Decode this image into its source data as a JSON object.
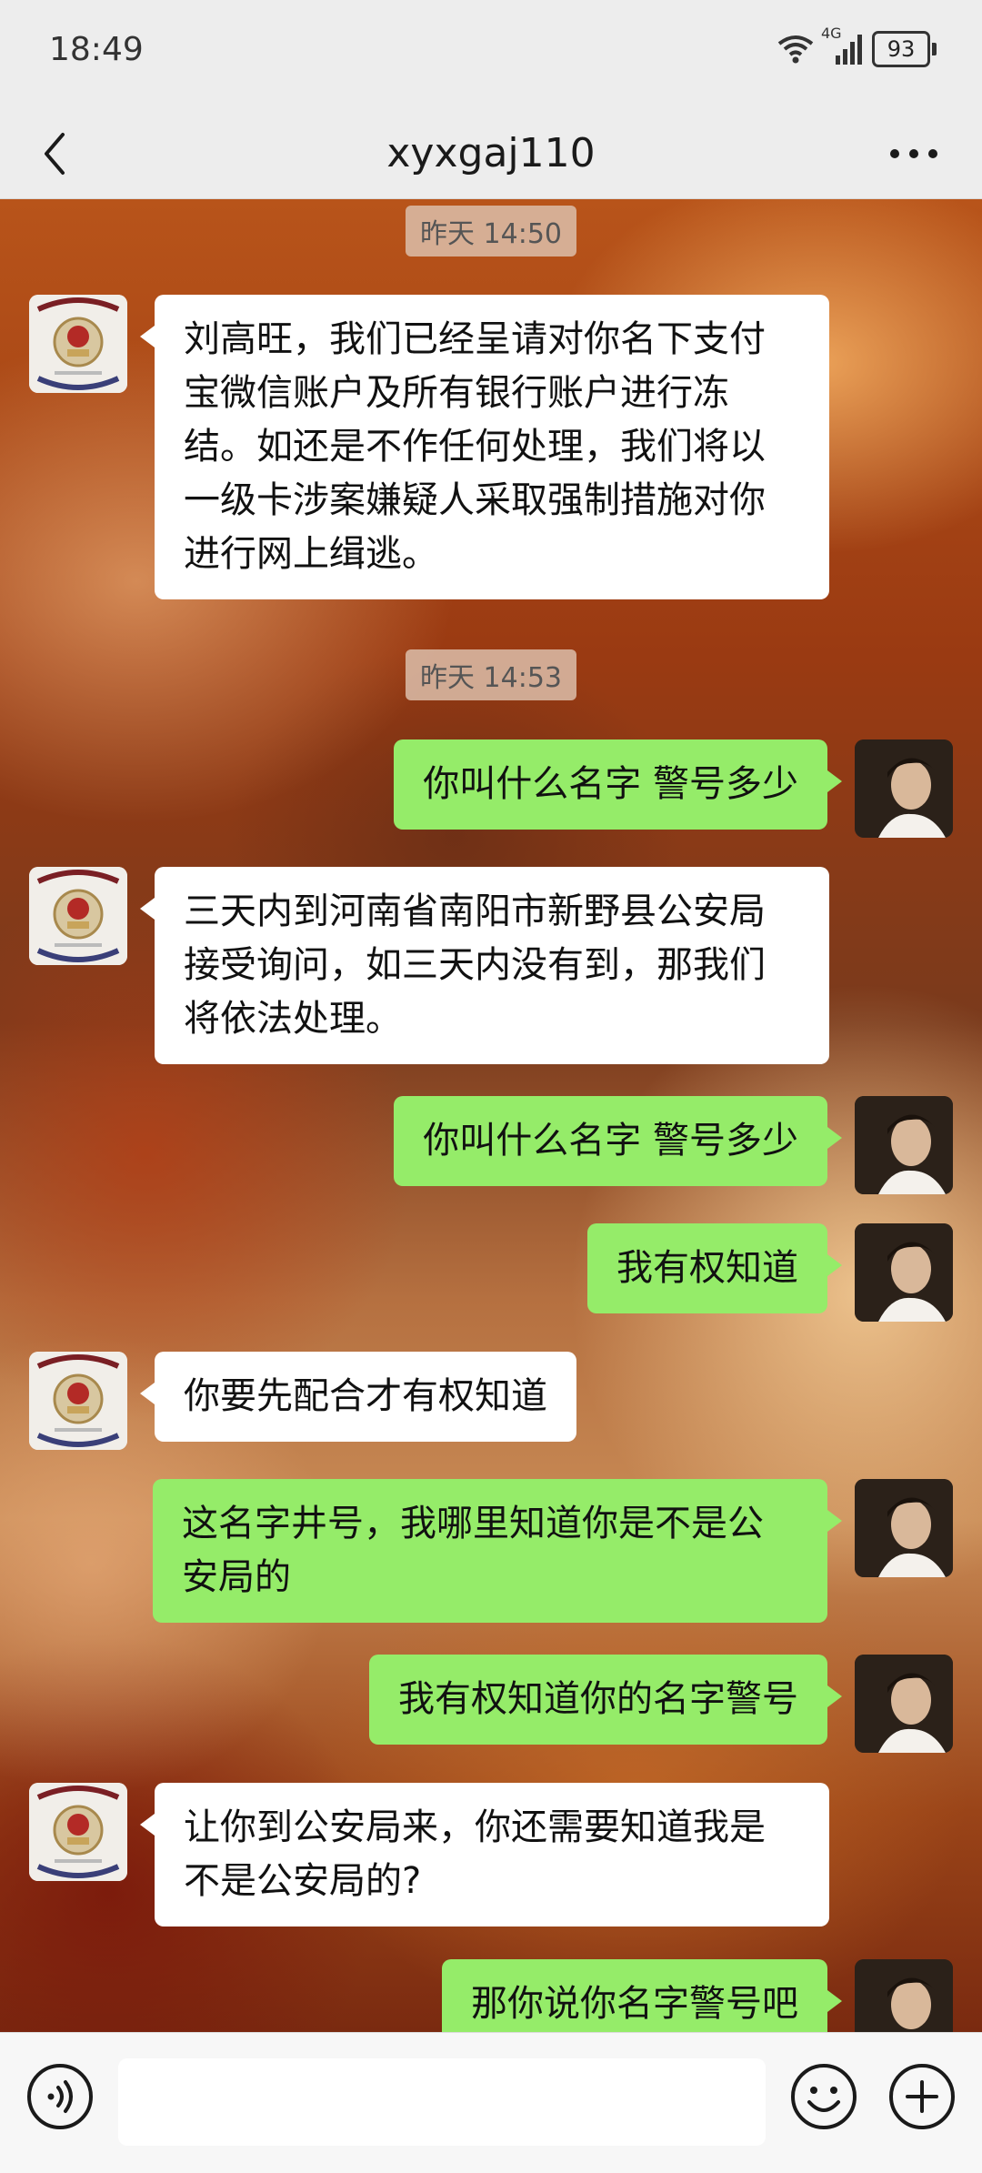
{
  "status_bar": {
    "time": "18:49",
    "network": "4G",
    "battery": "93"
  },
  "header": {
    "title": "xyxgaj110",
    "back_icon": "chevron-left-icon",
    "more_icon": "more-dots-icon"
  },
  "messages": [
    {
      "type": "timestamp",
      "text": "昨天 14:50"
    },
    {
      "type": "in",
      "text": "刘高旺，我们已经呈请对你名下支付宝微信账户及所有银行账户进行冻结。如还是不作任何处理，我们将以一级卡涉案嫌疑人采取强制措施对你进行网上缉逃。"
    },
    {
      "type": "timestamp",
      "text": "昨天 14:53"
    },
    {
      "type": "out",
      "text": "你叫什么名字  警号多少"
    },
    {
      "type": "in",
      "text": "三天内到河南省南阳市新野县公安局接受询问，如三天内没有到，那我们将依法处理。"
    },
    {
      "type": "out",
      "text": "你叫什么名字  警号多少"
    },
    {
      "type": "out",
      "text": "我有权知道"
    },
    {
      "type": "in",
      "text": "你要先配合才有权知道"
    },
    {
      "type": "out",
      "text": "这名字井号，我哪里知道你是不是公安局的"
    },
    {
      "type": "out",
      "text": "我有权知道你的名字警号"
    },
    {
      "type": "in",
      "text": "让你到公安局来，你还需要知道我是不是公安局的?"
    },
    {
      "type": "out",
      "text": "那你说你名字警号吧"
    }
  ],
  "input_bar": {
    "voice_icon": "voice-icon",
    "emoji_icon": "emoji-icon",
    "plus_icon": "plus-icon",
    "input_value": ""
  },
  "colors": {
    "outgoing_bubble": "#95ec69",
    "incoming_bubble": "#ffffff",
    "bar_background": "#ededed"
  }
}
